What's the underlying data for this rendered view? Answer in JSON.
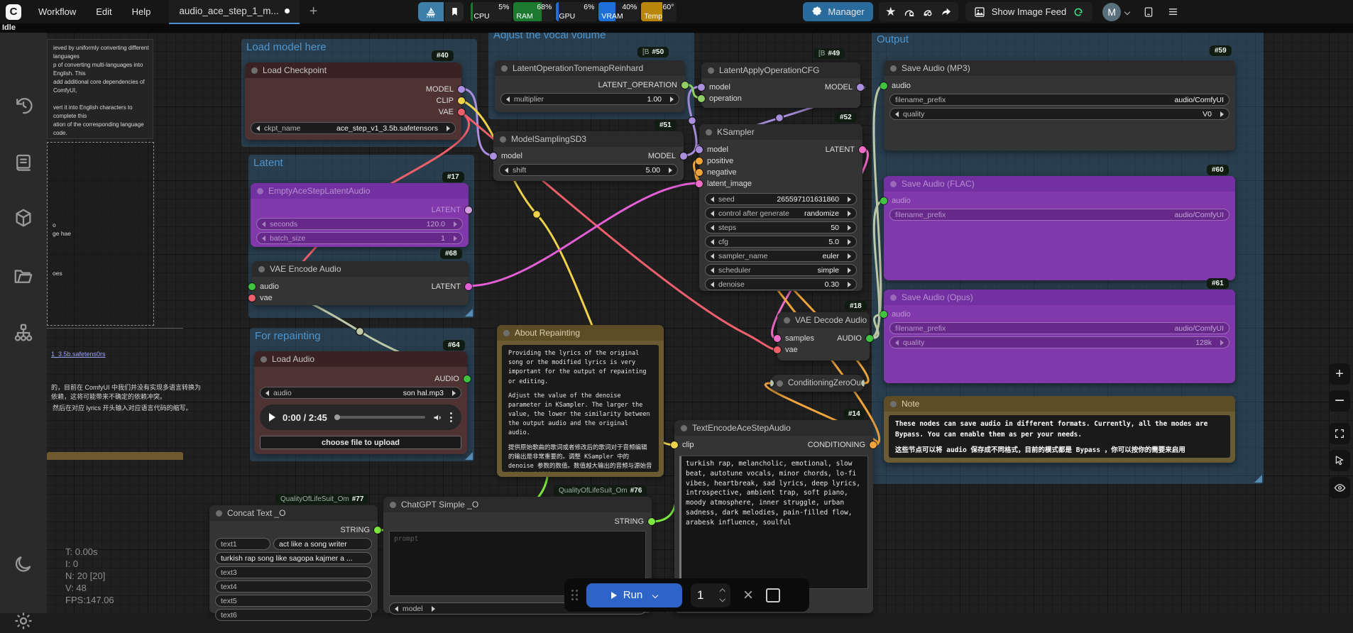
{
  "colors": {
    "accent_blue": "#2e64c8",
    "manager_blue": "#2a6b9e",
    "tab_underline": "#4a90d9",
    "group_fill": "#386c94",
    "badge_bg": "#101b12",
    "wire_model": "#a98fdd",
    "wire_clip": "#f0d24a",
    "wire_vae": "#ee5f6c",
    "wire_latent": "#f06cc7",
    "wire_audio": "#bcc8a6",
    "wire_conditioning": "#f0a43c",
    "wire_string": "#7ee63e",
    "ram_green": "#1b7a2f",
    "vram_blue": "#1e6fd9",
    "temp_amber": "#b8860b"
  },
  "topbar": {
    "logo": "C",
    "menus": [
      "Workflow",
      "Edit",
      "Help"
    ],
    "tab_title": "audio_ace_step_1_m...",
    "stats": [
      {
        "label": "CPU",
        "value": "5%"
      },
      {
        "label": "RAM",
        "value": "68%"
      },
      {
        "label": "GPU",
        "value": "6%"
      },
      {
        "label": "VRAM",
        "value": "40%"
      },
      {
        "label": "Temp",
        "value": "60°"
      }
    ],
    "manager_label": "Manager",
    "image_feed_label": "Show Image Feed",
    "avatar_initial": "M"
  },
  "statusbar": {
    "state": "Idle"
  },
  "perf": {
    "time": "T: 0.00s",
    "iterations": "I: 0",
    "nodes": "N: 20 [20]",
    "v": "V: 48",
    "fps": "FPS:147.06"
  },
  "runbar": {
    "run": "Run",
    "count": "1"
  },
  "groups": {
    "load_model": "Load model here",
    "adjust_vocal": "Adjust the vocal volume",
    "latent": "Latent",
    "repaint": "For repainting",
    "output": "Output"
  },
  "badges": {
    "load_checkpoint": "#40",
    "tonemap_pfx": "[B",
    "tonemap": "#50",
    "model_sampling": "#51",
    "apply_cfg_pfx": "[B",
    "apply_cfg": "#49",
    "ksampler": "#52",
    "empty_latent": "#17",
    "vae_encode": "#68",
    "load_audio": "#64",
    "vae_decode": "#18",
    "text_encode": "#14",
    "save_mp3": "#59",
    "save_flac": "#60",
    "save_opus": "#61",
    "concat_pfx": "QualityOfLifeSuit_Om",
    "concat": "#77",
    "chatgpt_pfx": "QualityOfLifeSuit_Om",
    "chatgpt": "#76"
  },
  "nodes": {
    "load_checkpoint": {
      "title": "Load Checkpoint",
      "out_model": "MODEL",
      "out_clip": "CLIP",
      "out_vae": "VAE",
      "ckpt_label": "ckpt_name",
      "ckpt_value": "ace_step_v1_3.5b.safetensors"
    },
    "tonemap": {
      "title": "LatentOperationTonemapReinhard",
      "out": "LATENT_OPERATION",
      "w_label": "multiplier",
      "w_value": "1.00"
    },
    "model_sampling": {
      "title": "ModelSamplingSD3",
      "in_model": "model",
      "out_model": "MODEL",
      "w_label": "shift",
      "w_value": "5.00"
    },
    "apply_cfg": {
      "title": "LatentApplyOperationCFG",
      "in_model": "model",
      "in_operation": "operation",
      "out_model": "MODEL"
    },
    "ksampler": {
      "title": "KSampler",
      "inputs": [
        "model",
        "positive",
        "negative",
        "latent_image"
      ],
      "out": "LATENT",
      "widgets": [
        {
          "l": "seed",
          "v": "265597101631860"
        },
        {
          "l": "control after generate",
          "v": "randomize"
        },
        {
          "l": "steps",
          "v": "50"
        },
        {
          "l": "cfg",
          "v": "5.0"
        },
        {
          "l": "sampler_name",
          "v": "euler"
        },
        {
          "l": "scheduler",
          "v": "simple"
        },
        {
          "l": "denoise",
          "v": "0.30"
        }
      ]
    },
    "empty_latent": {
      "title": "EmptyAceStepLatentAudio",
      "out": "LATENT",
      "w1_label": "seconds",
      "w1_value": "120.0",
      "w2_label": "batch_size",
      "w2_value": "1"
    },
    "vae_encode": {
      "title": "VAE Encode Audio",
      "in_audio": "audio",
      "in_vae": "vae",
      "out": "LATENT"
    },
    "load_audio": {
      "title": "Load Audio",
      "out": "AUDIO",
      "w_label": "audio",
      "w_value": "son hal.mp3",
      "player_time": "0:00 / 2:45",
      "upload": "choose file to upload"
    },
    "vae_decode": {
      "title": "VAE Decode Audio",
      "in_samples": "samples",
      "in_vae": "vae",
      "out": "AUDIO"
    },
    "cond_zero": {
      "title": "ConditioningZeroOut"
    },
    "text_encode": {
      "title": "TextEncodeAceStepAudio",
      "in_clip": "clip",
      "out": "CONDITIONING",
      "tags": "turkish rap, melancholic, emotional, slow beat, autotune vocals, minor chords, lo-fi vibes, heartbreak, sad lyrics, deep lyrics, introspective, ambient trap, soft piano, moody atmosphere, inner struggle, urban sadness, dark melodies, pain-filled flow, arabesk influence, soulful"
    },
    "save_mp3": {
      "title": "Save Audio (MP3)",
      "in_audio": "audio",
      "fn_label": "filename_prefix",
      "fn_value": "audio/ComfyUI",
      "q_label": "quality",
      "q_value": "V0"
    },
    "save_flac": {
      "title": "Save Audio (FLAC)",
      "in_audio": "audio",
      "fn_label": "filename_prefix",
      "fn_value": "audio/ComfyUI"
    },
    "save_opus": {
      "title": "Save Audio (Opus)",
      "in_audio": "audio",
      "fn_label": "filename_prefix",
      "fn_value": "audio/ComfyUI",
      "q_label": "quality",
      "q_value": "128k"
    },
    "concat": {
      "title": "Concat Text _O",
      "out": "STRING",
      "t1_label": "text1",
      "t1_value": "act like a song writer",
      "t2_value": "turkish rap song like sagopa kajmer a ...",
      "t3": "text3",
      "t4": "text4",
      "t5": "text5",
      "t6": "text6"
    },
    "chatgpt": {
      "title": "ChatGPT Simple _O",
      "out": "STRING",
      "prompt_placeholder": "prompt",
      "model_label": "model"
    }
  },
  "notes": {
    "about": {
      "title": "About Repainting",
      "p1": "Providing the lyrics of the original song or the modified lyrics is very important for the output of repainting or editing.",
      "p2": "Adjust the value of the denoise parameter in KSampler. The larger the value, the lower the similarity between the output audio and the original audio.",
      "p3": "提供原始歌曲的歌词或者修改后的歌词对于音频编辑的输出是非常重要的。调整 KSampler 中的 denoise 参数的数值。数值越大输出的音频与源始音频的相似度越低"
    },
    "output_note": {
      "title": "Note",
      "en": "These nodes can save audio in different formats. Currently, all the modes are Bypass. You can enable them as per your needs.",
      "cn": "这些节点可以将 audio  保存成不同格式，目前的模式都是 Bypass ，你可以按你的需要来启用"
    },
    "left_note_text": "ieved by uniformly converting different languages\np of converting multi-languages into English. This\nadd additional core dependencies of ComfyUI,\n\nvert it into English characters to complete this\nation of the corresponding language code.\n\no], and so on. For specific language input, please",
    "frag_a": "o",
    "frag_b": "ge hae",
    "frag_c": "oes",
    "link": "1_3.5b.safetens0rs",
    "cn1": "的，目前在 ComfyUI 中我们并没有实现多语言转换为",
    "cn2": "依赖，这将可能带来不确定的依赖冲突。",
    "cn3": "然后在对应 lyrics 开头输入对应语言代码的缩写。"
  }
}
